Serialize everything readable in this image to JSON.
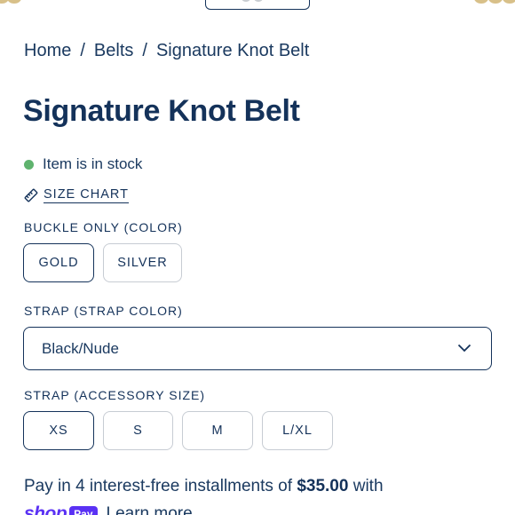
{
  "breadcrumb": {
    "items": [
      "Home",
      "Belts",
      "Signature Knot Belt"
    ],
    "separator": "/"
  },
  "product": {
    "title": "Signature Knot Belt",
    "stock_status": "Item is in stock",
    "stock_color": "#5fb36e"
  },
  "size_chart": {
    "label": "SIZE CHART",
    "icon": "ruler-icon"
  },
  "buckle": {
    "label": "BUCKLE ONLY (COLOR)",
    "options": [
      "GOLD",
      "SILVER"
    ],
    "selected": "GOLD"
  },
  "strap_color": {
    "label": "STRAP (STRAP COLOR)",
    "value": "Black/Nude",
    "icon": "chevron-down-icon"
  },
  "strap_size": {
    "label": "STRAP (ACCESSORY SIZE)",
    "options": [
      "XS",
      "S",
      "M",
      "L/XL"
    ],
    "selected": "XS"
  },
  "installments": {
    "prefix": "Pay in 4 interest-free installments of ",
    "amount": "$35.00",
    "suffix": " with"
  },
  "shop_pay": {
    "shop_word": "shop",
    "pay_word": "Pay",
    "learn_more": "Learn more",
    "brand_color": "#5a31f4"
  },
  "colors": {
    "primary": "#14325a",
    "border_muted": "#c7ccd3"
  }
}
